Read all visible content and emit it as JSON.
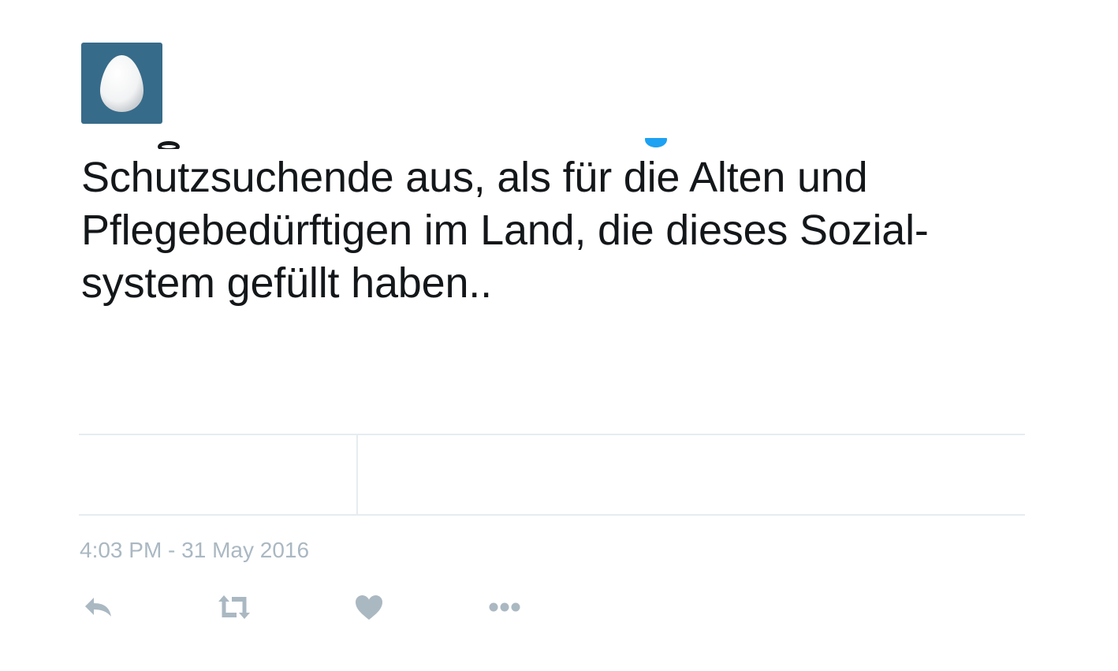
{
  "tweet": {
    "text_lines": [
      "Schutzsuchende aus, als für die Alten und",
      "Pflegebedürftigen im Land, die dieses Sozial-",
      "system gefüllt haben.."
    ],
    "timestamp": "4:03 PM - 31 May 2016"
  },
  "avatar": {
    "icon": "default-egg-avatar",
    "background_color": "#376b8a"
  },
  "actions": [
    {
      "name": "reply",
      "icon": "reply-icon"
    },
    {
      "name": "retweet",
      "icon": "retweet-icon"
    },
    {
      "name": "like",
      "icon": "heart-icon"
    },
    {
      "name": "more",
      "icon": "more-dots-icon"
    }
  ],
  "colors": {
    "text": "#14171a",
    "muted": "#aab8c2",
    "divider": "#e6ecf0",
    "accent": "#1da1f2"
  }
}
